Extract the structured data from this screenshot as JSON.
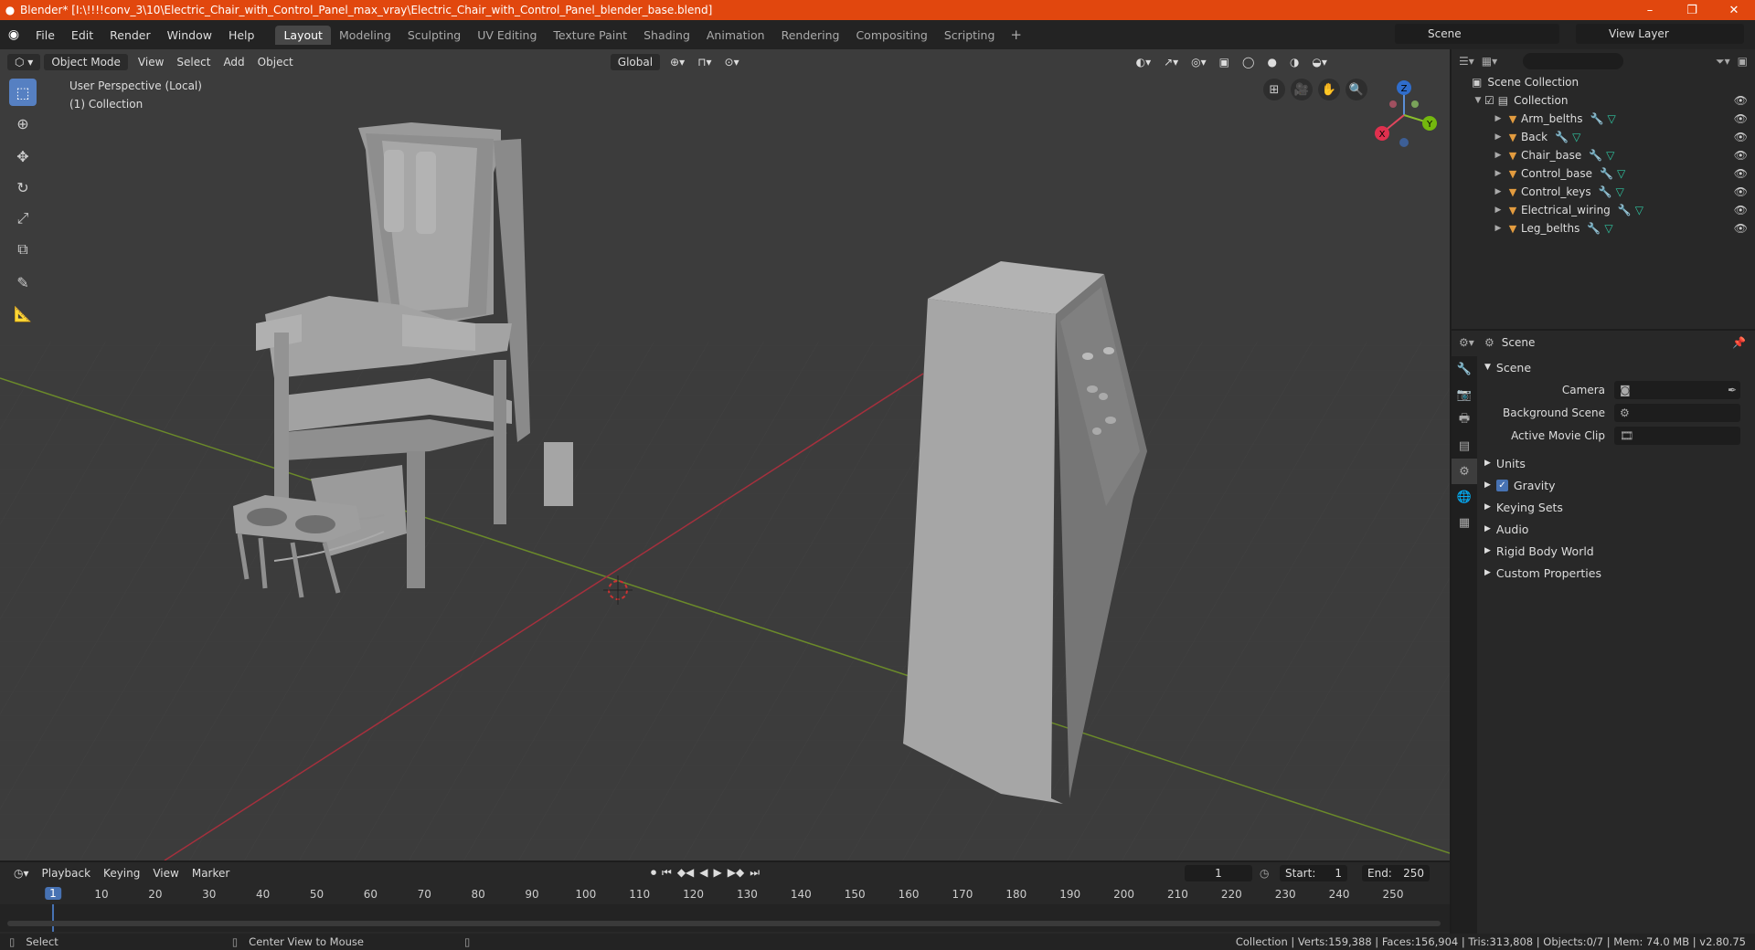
{
  "window": {
    "title": "Blender* [I:\\!!!!conv_3\\10\\Electric_Chair_with_Control_Panel_max_vray\\Electric_Chair_with_Control_Panel_blender_base.blend]",
    "minimize": "–",
    "maximize": "❐",
    "close": "✕"
  },
  "menu": [
    "File",
    "Edit",
    "Render",
    "Window",
    "Help"
  ],
  "workspaces": [
    "Layout",
    "Modeling",
    "Sculpting",
    "UV Editing",
    "Texture Paint",
    "Shading",
    "Animation",
    "Rendering",
    "Compositing",
    "Scripting"
  ],
  "active_workspace": "Layout",
  "scene_name": "Scene",
  "view_layer": "View Layer",
  "viewport": {
    "mode": "Object Mode",
    "menus": [
      "View",
      "Select",
      "Add",
      "Object"
    ],
    "orientation": "Global",
    "perspective_label": "User Perspective (Local)",
    "collection_label": "(1) Collection",
    "gizmo": {
      "x": "X",
      "y": "Y",
      "z": "Z"
    }
  },
  "tools": [
    "select-box",
    "cursor",
    "move",
    "rotate",
    "scale",
    "transform",
    "annotate",
    "measure"
  ],
  "outliner": {
    "search_placeholder": "",
    "scene_collection": "Scene Collection",
    "collection": "Collection",
    "objects": [
      "Arm_belths",
      "Back",
      "Chair_base",
      "Control_base",
      "Control_keys",
      "Electrical_wiring",
      "Leg_belths"
    ]
  },
  "properties": {
    "context": "Scene",
    "panel": "Scene",
    "camera_label": "Camera",
    "background_scene_label": "Background Scene",
    "active_movie_clip_label": "Active Movie Clip",
    "sub_panels": [
      "Units",
      "Gravity",
      "Keying Sets",
      "Audio",
      "Rigid Body World",
      "Custom Properties"
    ],
    "gravity_checked": true
  },
  "timeline": {
    "menus": [
      "Playback",
      "Keying",
      "View",
      "Marker"
    ],
    "current_frame": "1",
    "start_label": "Start:",
    "start": "1",
    "end_label": "End:",
    "end": "250",
    "ruler": [
      "10",
      "20",
      "30",
      "40",
      "50",
      "60",
      "70",
      "80",
      "90",
      "100",
      "110",
      "120",
      "130",
      "140",
      "150",
      "160",
      "170",
      "180",
      "190",
      "200",
      "210",
      "220",
      "230",
      "240",
      "250"
    ],
    "cursor_frame": "1"
  },
  "statusbar": {
    "select": "Select",
    "center_view": "Center View to Mouse",
    "stats": "Collection | Verts:159,388 | Faces:156,904 | Tris:313,808 | Objects:0/7 | Mem: 74.0 MB | v2.80.75"
  }
}
